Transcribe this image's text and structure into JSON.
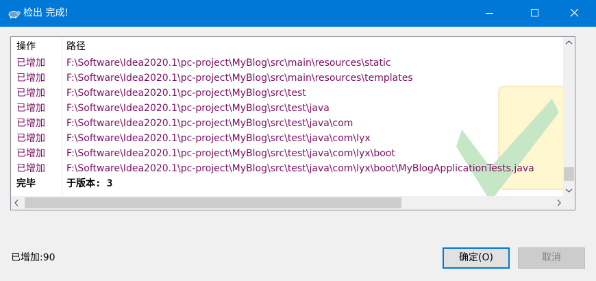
{
  "window": {
    "title": "检出 完成!",
    "controls": [
      "minimize-icon",
      "maximize-icon",
      "close-icon"
    ]
  },
  "list": {
    "columns": {
      "action": "操作",
      "path": "路径"
    },
    "rows": [
      {
        "action": "已增加",
        "path": "F:\\Software\\Idea2020.1\\pc-project\\MyBlog\\src\\main\\resources\\static"
      },
      {
        "action": "已增加",
        "path": "F:\\Software\\Idea2020.1\\pc-project\\MyBlog\\src\\main\\resources\\templates"
      },
      {
        "action": "已增加",
        "path": "F:\\Software\\Idea2020.1\\pc-project\\MyBlog\\src\\test"
      },
      {
        "action": "已增加",
        "path": "F:\\Software\\Idea2020.1\\pc-project\\MyBlog\\src\\test\\java"
      },
      {
        "action": "已增加",
        "path": "F:\\Software\\Idea2020.1\\pc-project\\MyBlog\\src\\test\\java\\com"
      },
      {
        "action": "已增加",
        "path": "F:\\Software\\Idea2020.1\\pc-project\\MyBlog\\src\\test\\java\\com\\lyx"
      },
      {
        "action": "已增加",
        "path": "F:\\Software\\Idea2020.1\\pc-project\\MyBlog\\src\\test\\java\\com\\lyx\\boot"
      },
      {
        "action": "已增加",
        "path": "F:\\Software\\Idea2020.1\\pc-project\\MyBlog\\src\\test\\java\\com\\lyx\\boot\\MyBlogApplicationTests.java"
      },
      {
        "action": "完毕",
        "path": "于版本: 3"
      }
    ],
    "row_color": "#7a0f62"
  },
  "footer": {
    "status": "已增加:90",
    "ok_label": "确定(O)",
    "cancel_label": "取消"
  },
  "colors": {
    "titlebar": "#0078d7",
    "accent": "#0078d7"
  }
}
